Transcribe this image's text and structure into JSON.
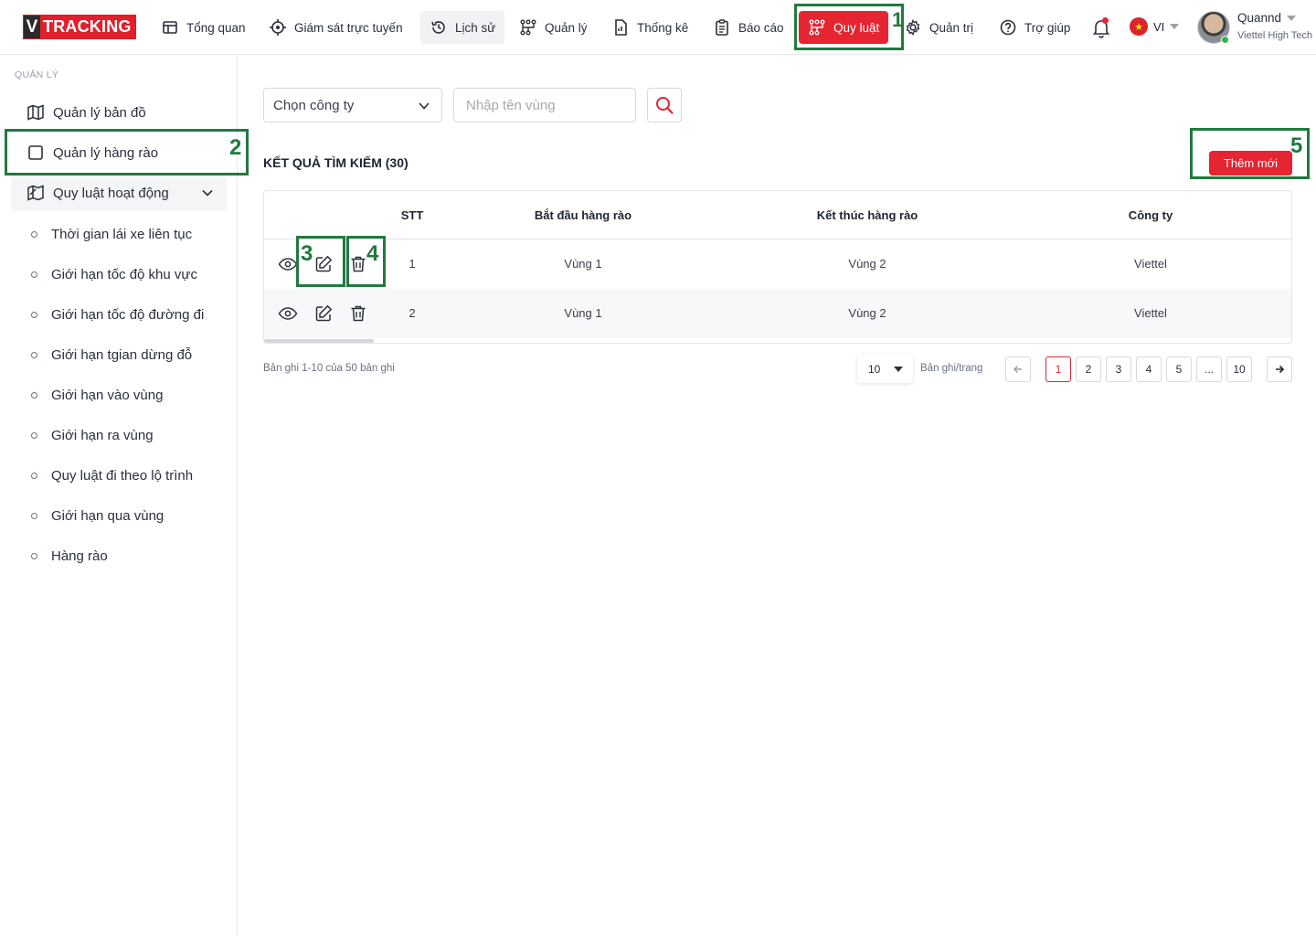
{
  "brand": {
    "logo_v": "V",
    "logo_text": "TRACKING"
  },
  "nav": [
    {
      "label": "Tổng quan",
      "icon": "dashboard-icon"
    },
    {
      "label": "Giám sát trực tuyến",
      "icon": "target-icon"
    },
    {
      "label": "Lịch sử",
      "icon": "history-icon"
    },
    {
      "label": "Quản lý",
      "icon": "manage-icon"
    },
    {
      "label": "Thống kê",
      "icon": "report-file-icon"
    },
    {
      "label": "Báo cáo",
      "icon": "clipboard-icon"
    },
    {
      "label": "Quy luật",
      "icon": "rules-icon",
      "active": true
    },
    {
      "label": "Quản trị",
      "icon": "gear-icon"
    },
    {
      "label": "Trợ giúp",
      "icon": "help-icon"
    }
  ],
  "language": {
    "code": "VI",
    "flag_star": "★"
  },
  "user": {
    "name": "Quannd",
    "org": "Viettel High Tech"
  },
  "sidebar": {
    "heading": "QUẢN LÝ",
    "items": [
      {
        "label": "Quản lý bản đồ",
        "icon": "map-icon"
      },
      {
        "label": "Quản lý hàng rào",
        "icon": "square-icon"
      },
      {
        "label": "Quy luật hoạt động",
        "icon": "map-rules-icon",
        "expanded": true
      }
    ],
    "sub_items": [
      "Thời gian lái xe liên tục",
      "Giới hạn tốc độ khu vực",
      "Giới hạn tốc độ đường đi",
      "Giới hạn tgian dừng đỗ",
      "Giới hạn vào vùng",
      "Giới hạn ra vùng",
      "Quy luật đi theo lộ trình",
      "Giới hạn qua vùng",
      "Hàng rào"
    ]
  },
  "filters": {
    "company_select": "Chọn công ty",
    "zone_placeholder": "Nhập tên vùng"
  },
  "results": {
    "title": "KẾT QUẢ TÌM KIẾM (30)",
    "add_button": "Thêm mới"
  },
  "table": {
    "columns": [
      "STT",
      "Bắt đầu hàng rào",
      "Kết thúc hàng rào",
      "Công ty"
    ],
    "rows": [
      [
        "1",
        "Vùng 1",
        "Vùng 2",
        "Viettel"
      ],
      [
        "2",
        "Vùng 1",
        "Vùng 2",
        "Viettel"
      ]
    ]
  },
  "pagination": {
    "summary": "Bản ghi 1-10 của 50 bản ghi",
    "page_size": "10",
    "per_page_label": "Bản ghi/trang",
    "pages": [
      "1",
      "2",
      "3",
      "4",
      "5",
      "...",
      "10"
    ],
    "current": "1"
  },
  "annotations": [
    "1",
    "2",
    "3",
    "4",
    "5"
  ],
  "colors": {
    "accent": "#e52531",
    "annotation": "#1f7a3e"
  }
}
